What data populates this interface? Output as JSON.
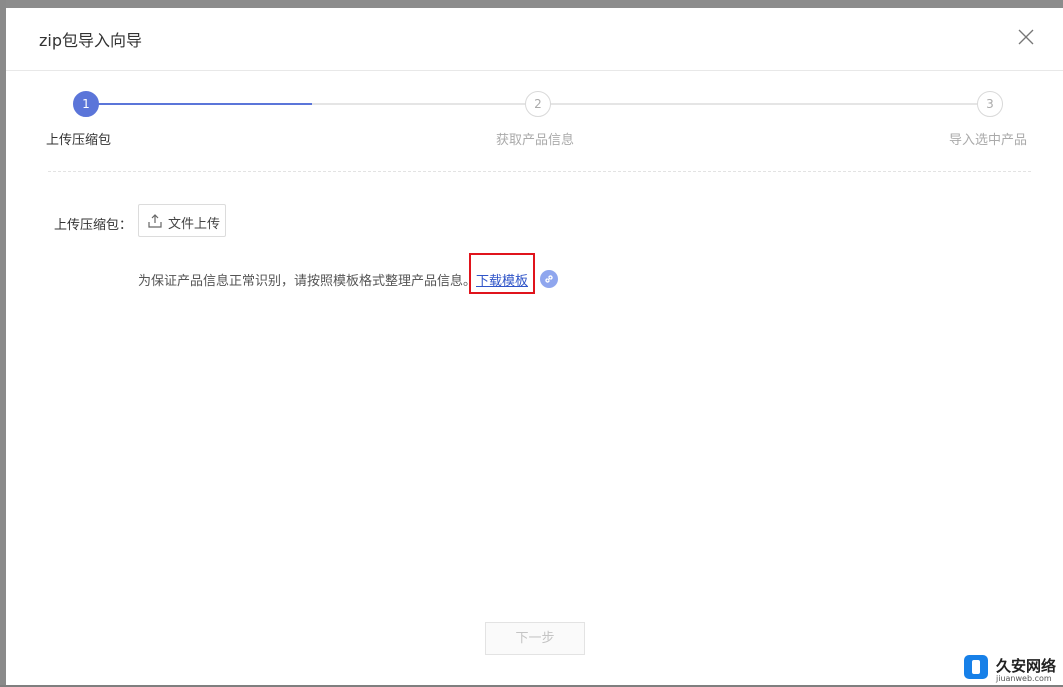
{
  "dialog": {
    "title": "zip包导入向导",
    "close_icon": "close-icon"
  },
  "steps": [
    {
      "number": "1",
      "label": "上传压缩包",
      "state": "active"
    },
    {
      "number": "2",
      "label": "获取产品信息",
      "state": "pending"
    },
    {
      "number": "3",
      "label": "导入选中产品",
      "state": "pending"
    }
  ],
  "upload": {
    "field_label": "上传压缩包：",
    "button_label": "文件上传",
    "button_icon": "upload-icon"
  },
  "hint": {
    "text": "为保证产品信息正常识别，请按照模板格式整理产品信息。",
    "link_label": "下载模板",
    "link_icon": "link-icon"
  },
  "footer": {
    "next_label": "下一步"
  },
  "watermark": {
    "title": "久安网络",
    "subtitle": "jiuanweb.com"
  },
  "colors": {
    "accent": "#5b75d9",
    "highlight_box": "#e0141c",
    "link": "#2f54c8"
  }
}
